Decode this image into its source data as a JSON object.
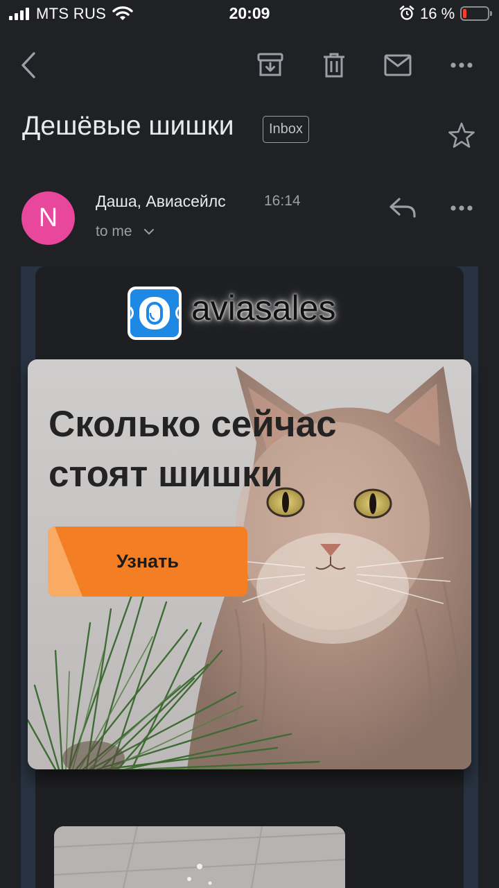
{
  "status": {
    "carrier": "MTS RUS",
    "time": "20:09",
    "battery_percent": "16 %",
    "battery_level": 0.16
  },
  "toolbar": {
    "icons": [
      "back-icon",
      "archive-icon",
      "trash-icon",
      "mail-icon",
      "more-icon"
    ]
  },
  "email": {
    "subject": "Дешёвые шишки",
    "label": "Inbox",
    "sender_initial": "N",
    "sender": "Даша, Авиасейлс",
    "time": "16:14",
    "recipient": "to me",
    "avatar_color": "#e8479b"
  },
  "content": {
    "brand": "aviasales",
    "brand_color": "#1e88e5",
    "headline": "Сколько сейчас стоят шишки",
    "cta_label": "Узнать",
    "cta_color": "#f37e24"
  }
}
